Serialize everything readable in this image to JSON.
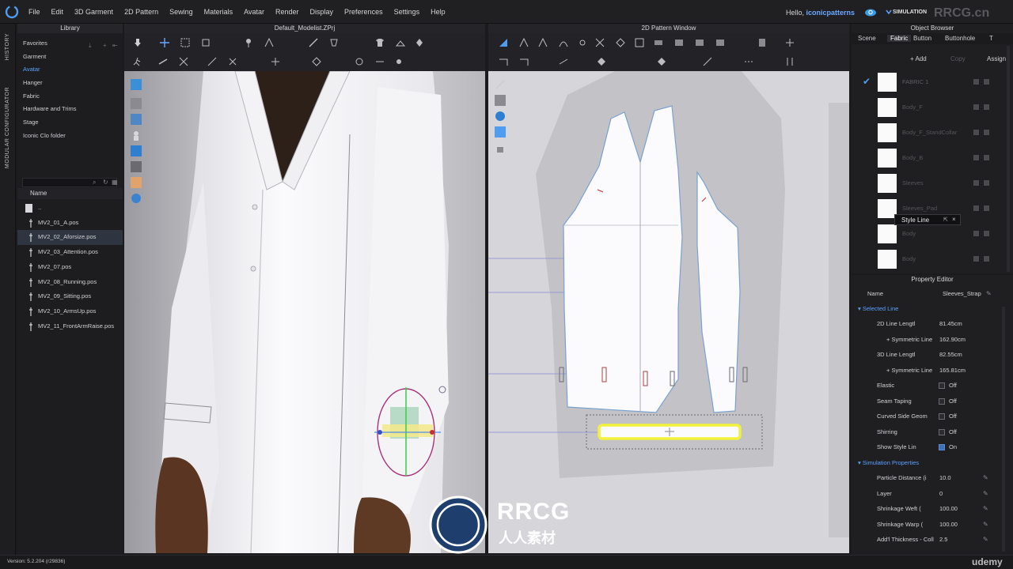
{
  "menubar": {
    "items": [
      "File",
      "Edit",
      "3D Garment",
      "2D Pattern",
      "Sewing",
      "Materials",
      "Avatar",
      "Render",
      "Display",
      "Preferences",
      "Settings",
      "Help"
    ],
    "greeting": "Hello, ",
    "username": "iconicpatterns",
    "mode": "SIMULATION",
    "watermark": "RRCG.cn"
  },
  "sidebar": {
    "history": "HISTORY",
    "modular": "MODULAR CONFIGURATOR"
  },
  "library": {
    "title": "Library",
    "categories": [
      "Favorites",
      "Garment",
      "Avatar",
      "Hanger",
      "Fabric",
      "Hardware and Trims",
      "Stage",
      "Iconic Clo folder"
    ],
    "active_category": "Avatar",
    "column_header": "Name",
    "files": [
      "..",
      "MV2_01_A.pos",
      "MV2_02_Aforsize.pos",
      "MV2_03_Attention.pos",
      "MV2_07.pos",
      "MV2_08_Running.pos",
      "MV2_09_Sitting.pos",
      "MV2_10_ArmsUp.pos",
      "MV2_11_FrontArmRaise.pos"
    ],
    "selected_file": "MV2_02_Aforsize.pos"
  },
  "viewport3d": {
    "title": "Default_Modelist.ZPrj"
  },
  "viewport2d": {
    "title": "2D Pattern Window"
  },
  "object_browser": {
    "title": "Object Browser",
    "tabs": [
      "Scene",
      "Fabric",
      "Button",
      "Buttonhole",
      "T"
    ],
    "active_tab": "Fabric",
    "actions": [
      "+ Add",
      "Copy",
      "Assign"
    ],
    "fabrics": [
      "FABRIC 1",
      "Body_F",
      "Body_F_StandCollar",
      "Body_B",
      "Sleeves",
      "Sleeves_Pad",
      "Body",
      "Body"
    ],
    "tooltip": "Style Line"
  },
  "property_editor": {
    "title": "Property Editor",
    "name_label": "Name",
    "name_value": "Sleeves_Strap",
    "selected_line_section": "Selected Line",
    "rows": [
      {
        "label": "2D Line Lengtl",
        "value": "81.45cm",
        "sub": false
      },
      {
        "label": "+ Symmetric Line",
        "value": "162.90cm",
        "sub": true
      },
      {
        "label": "3D Line Lengtl",
        "value": "82.55cm",
        "sub": false
      },
      {
        "label": "+ Symmetric Line",
        "value": "165.81cm",
        "sub": true
      },
      {
        "label": "Elastic",
        "value": "Off",
        "checkbox": "off"
      },
      {
        "label": "Seam Taping",
        "value": "Off",
        "checkbox": "off"
      },
      {
        "label": "Curved Side Geom",
        "value": "Off",
        "checkbox": "off"
      },
      {
        "label": "Shirring",
        "value": "Off",
        "checkbox": "off"
      },
      {
        "label": "Show Style Lin",
        "value": "On",
        "checkbox": "on"
      }
    ],
    "simulation_section": "Simulation Properties",
    "sim_rows": [
      {
        "label": "Particle Distance (i",
        "value": "10.0"
      },
      {
        "label": "Layer",
        "value": "0"
      },
      {
        "label": "Shrinkage Weft (",
        "value": "100.00"
      },
      {
        "label": "Shrinkage Warp (",
        "value": "100.00"
      },
      {
        "label": "Add'l Thickness - Coll",
        "value": "2.5"
      }
    ]
  },
  "statusbar": {
    "version": "Version: 5.2.204 (r29836)",
    "udemy": "udemy"
  },
  "watermark": {
    "logo_text": "RRCG",
    "logo_sub": "人人素材"
  },
  "colors": {
    "accent": "#5aa2ff",
    "selection_yellow": "#f2f23a",
    "garment_white": "#fbfbfd",
    "viewport_gray": "#c9c9ce"
  }
}
